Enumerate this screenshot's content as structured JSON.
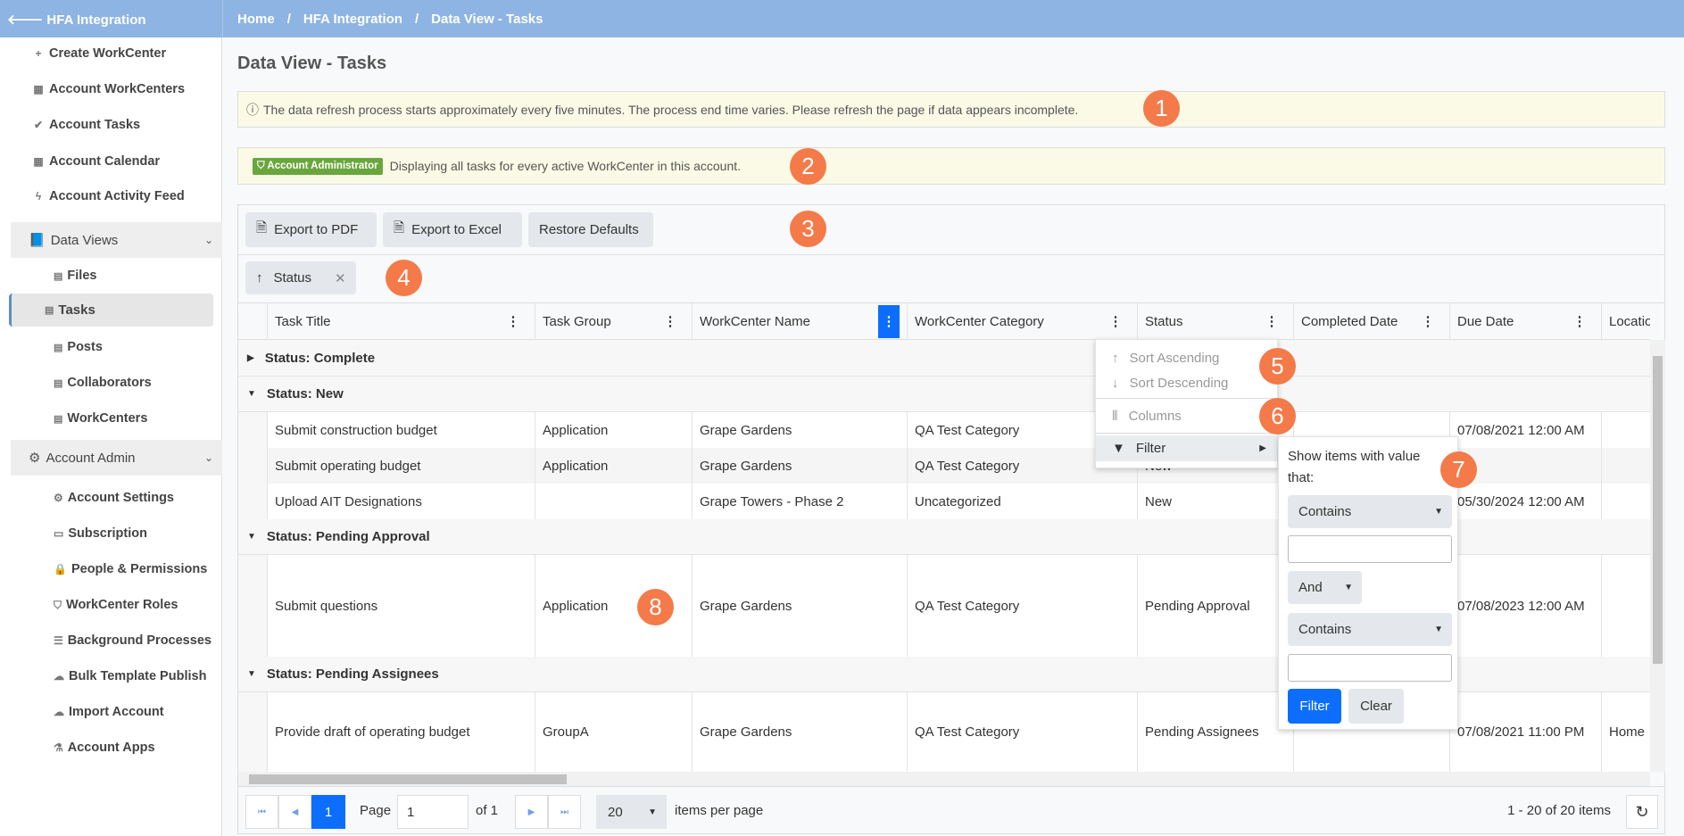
{
  "topbar": {
    "back_label": "HFA Integration",
    "breadcrumb": [
      "Home",
      "HFA Integration",
      "Data View - Tasks"
    ]
  },
  "sidebar": {
    "items": [
      {
        "icon": "plus-icon",
        "glyph": "+",
        "label": "Create WorkCenter"
      },
      {
        "icon": "grid-icon",
        "glyph": "▦",
        "label": "Account WorkCenters"
      },
      {
        "icon": "check-icon",
        "glyph": "✔",
        "label": "Account Tasks"
      },
      {
        "icon": "calendar-icon",
        "glyph": "▦",
        "label": "Account Calendar"
      },
      {
        "icon": "bolt-icon",
        "glyph": "ϟ",
        "label": "Account Activity Feed"
      }
    ],
    "data_views": {
      "label": "Data Views",
      "items": [
        "Files",
        "Tasks",
        "Posts",
        "Collaborators",
        "WorkCenters"
      ],
      "selected": "Tasks"
    },
    "account_admin": {
      "label": "Account Admin",
      "items": [
        {
          "icon": "gear-icon",
          "glyph": "⚙",
          "label": "Account Settings"
        },
        {
          "icon": "money-icon",
          "glyph": "▭",
          "label": "Subscription"
        },
        {
          "icon": "lock-icon",
          "glyph": "🔒",
          "label": "People & Permissions"
        },
        {
          "icon": "shield-icon",
          "glyph": "⛉",
          "label": "WorkCenter Roles"
        },
        {
          "icon": "list-icon",
          "glyph": "☰",
          "label": "Background Processes"
        },
        {
          "icon": "cloud-icon",
          "glyph": "☁",
          "label": "Bulk Template Publish"
        },
        {
          "icon": "cloud-icon",
          "glyph": "☁",
          "label": "Import Account"
        },
        {
          "icon": "flask-icon",
          "glyph": "⚗",
          "label": "Account Apps"
        }
      ]
    }
  },
  "page": {
    "title": "Data View - Tasks",
    "info_alert": "The data refresh process starts approximately every five minutes. The process end time varies. Please refresh the page if data appears incomplete.",
    "role_badge": "Account Administrator",
    "role_alert": "Displaying all tasks for every active WorkCenter in this account."
  },
  "toolbar": {
    "export_pdf": "Export to PDF",
    "export_excel": "Export to Excel",
    "restore": "Restore Defaults"
  },
  "group_chip": {
    "label": "Status"
  },
  "columns": [
    "Task Title",
    "Task Group",
    "WorkCenter Name",
    "WorkCenter Category",
    "Status",
    "Completed Date",
    "Due Date",
    "Location"
  ],
  "groups": [
    {
      "label": "Status: Complete",
      "expanded": false,
      "rows": []
    },
    {
      "label": "Status: New",
      "expanded": true,
      "rows": [
        [
          "Submit construction budget",
          "Application",
          "Grape Gardens",
          "QA Test Category",
          "New",
          "",
          "07/08/2021 12:00 AM",
          ""
        ],
        [
          "Submit operating budget",
          "Application",
          "Grape Gardens",
          "QA Test Category",
          "New",
          "",
          "",
          ""
        ],
        [
          "Upload AIT Designations",
          "",
          "Grape Towers - Phase 2",
          "Uncategorized",
          "New",
          "",
          "05/30/2024 12:00 AM",
          ""
        ]
      ]
    },
    {
      "label": "Status: Pending Approval",
      "expanded": true,
      "rows": [
        [
          "Submit questions",
          "Application",
          "Grape Gardens",
          "QA Test Category",
          "Pending Approval",
          "",
          "07/08/2023 12:00 AM",
          ""
        ]
      ]
    },
    {
      "label": "Status: Pending Assignees",
      "expanded": true,
      "rows": [
        [
          "Provide draft of operating budget",
          "GroupA",
          "Grape Gardens",
          "QA Test Category",
          "Pending Assignees",
          "",
          "07/08/2021 11:00 PM",
          "Home"
        ]
      ]
    }
  ],
  "column_menu": {
    "sort_asc": "Sort Ascending",
    "sort_desc": "Sort Descending",
    "columns": "Columns",
    "filter": "Filter"
  },
  "filter_panel": {
    "intro": "Show items with value that:",
    "operator1": "Contains",
    "logic": "And",
    "operator2": "Contains",
    "value1": "",
    "value2": "",
    "filter_button": "Filter",
    "clear_button": "Clear"
  },
  "pager": {
    "current_page": "1",
    "page_label": "Page",
    "page_input": "1",
    "of_label": "of 1",
    "page_size": "20",
    "per_page_label": "items per page",
    "summary": "1 - 20 of 20 items"
  },
  "callouts": [
    "1",
    "2",
    "3",
    "4",
    "5",
    "6",
    "7",
    "8"
  ],
  "colors": {
    "accent": "#0d6efd",
    "topbar": "#8db4e2",
    "callout": "#f47a4a",
    "admin_badge": "#6aa63d"
  }
}
